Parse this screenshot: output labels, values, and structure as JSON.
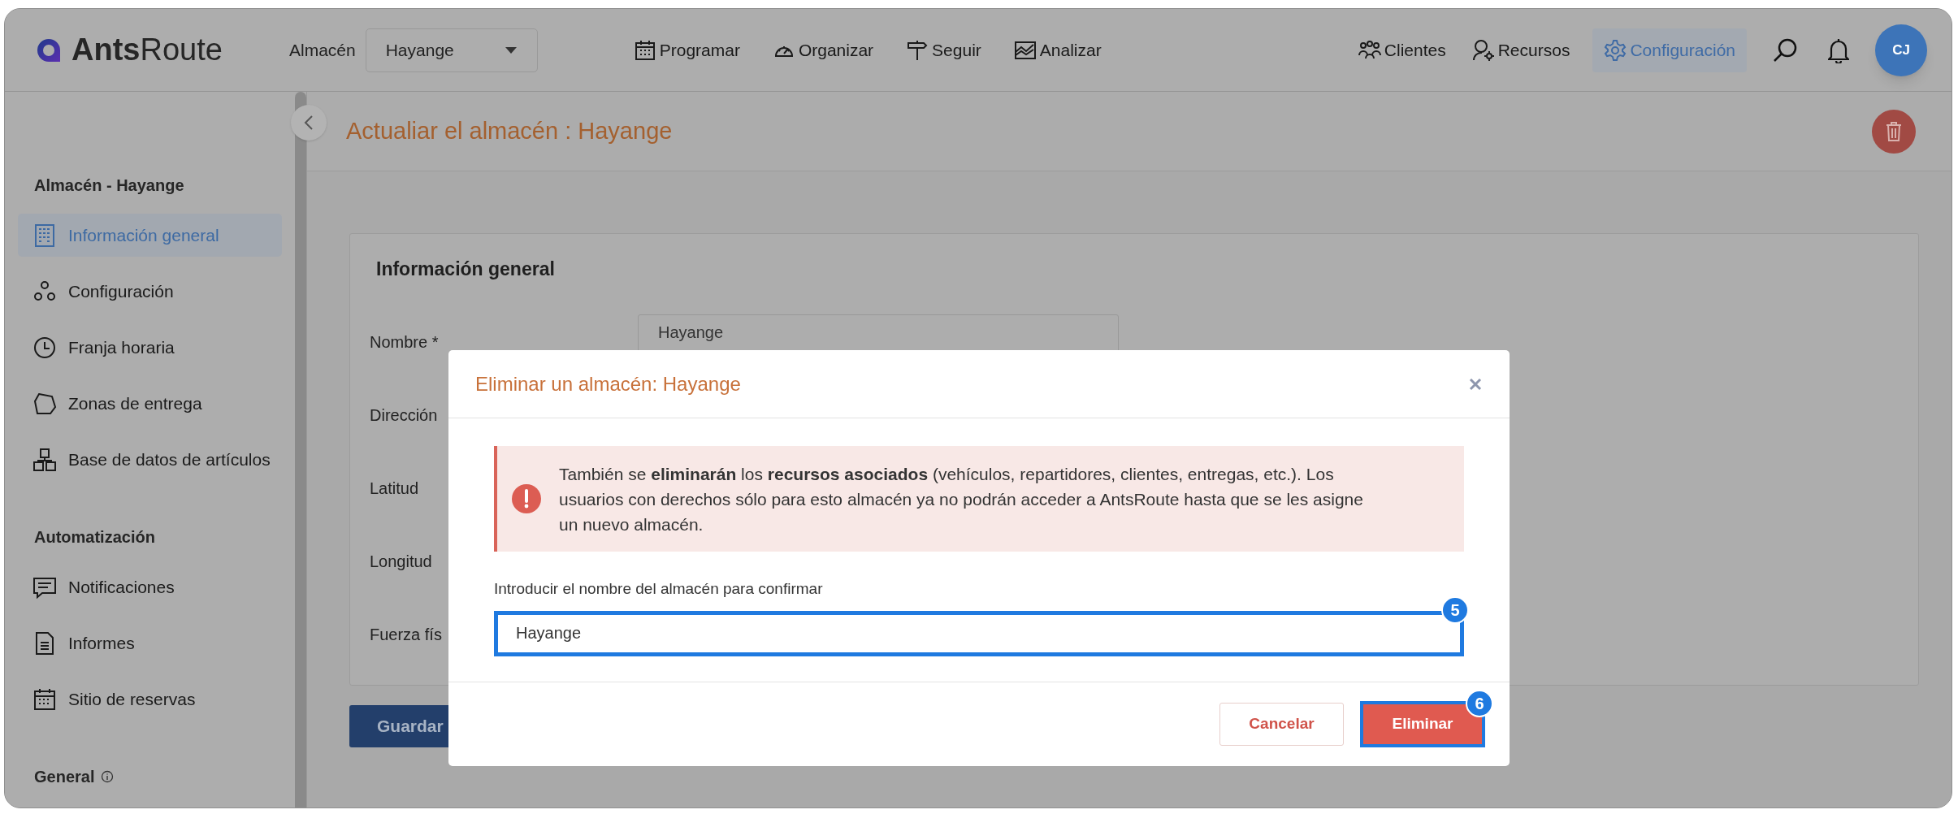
{
  "top_bar": {
    "logo": "**Ants**Route",
    "warehouse_label": "Almacén",
    "warehouse_select": "Hayange",
    "nav": [
      {
        "label": "Programar"
      },
      {
        "label": "Organizar"
      },
      {
        "label": "Seguir"
      },
      {
        "label": "Analizar"
      }
    ],
    "nav_right": [
      {
        "label": "Clientes",
        "selected": false
      },
      {
        "label": "Recursos",
        "selected": false
      },
      {
        "label": "Configuración",
        "selected": true
      }
    ],
    "avatar": "CJ"
  },
  "sidebar": {
    "sections": [
      {
        "title": "Almacén - Hayange",
        "items": [
          {
            "label": "Información general",
            "selected": true
          },
          {
            "label": "Configuración",
            "selected": false
          },
          {
            "label": "Franja horaria",
            "selected": false
          },
          {
            "label": "Zonas de entrega",
            "selected": false
          },
          {
            "label": "Base de datos de artículos",
            "selected": false
          }
        ]
      },
      {
        "title": "Automatización",
        "items": [
          {
            "label": "Notificaciones",
            "selected": false
          },
          {
            "label": "Informes",
            "selected": false
          },
          {
            "label": "Sitio de reservas",
            "selected": false
          }
        ]
      },
      {
        "title": "General",
        "info": true
      }
    ]
  },
  "page_title": "Actualiar el almacén : Hayange",
  "form": {
    "title": "Información general",
    "fields": [
      {
        "label": "Nombre *",
        "value": "Hayange"
      },
      {
        "label": "Dirección"
      },
      {
        "label": "Latitud"
      },
      {
        "label": "Longitud"
      },
      {
        "label": "Fuerza fís"
      }
    ],
    "save_button": "Guardar"
  },
  "dialog": {
    "title": "Eliminar un almacén: Hayange",
    "alert": "También se **eliminarán** los **recursos asociados** (vehículos, repartidores, clientes, entregas, etc.). Los usuarios con derechos sólo para esto almacén ya no podrán acceder a AntsRoute hasta que se les asigne un nuevo almacén.",
    "confirm_label": "Introducir el nombre del almacén para confirmar",
    "confirm_value": "Hayange",
    "cancel": "Cancelar",
    "delete": "Eliminar",
    "badges": [
      "5",
      "6"
    ]
  }
}
